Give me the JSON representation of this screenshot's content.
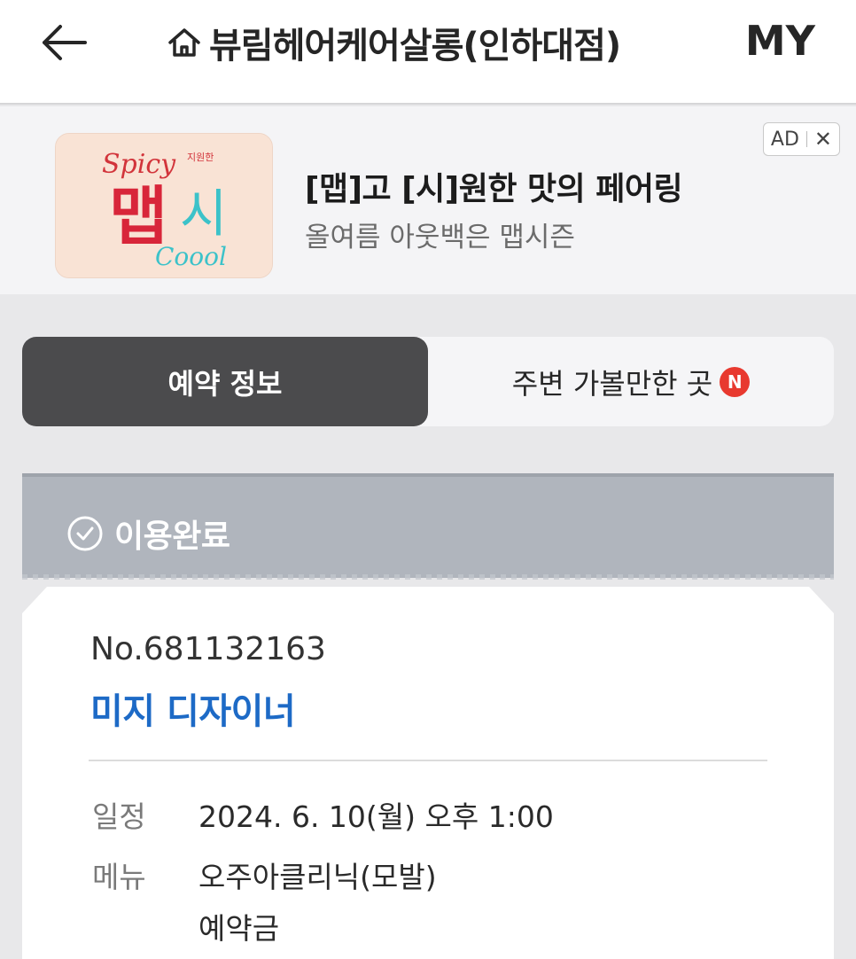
{
  "header": {
    "title": "뷰림헤어케어살롱(인하대점)",
    "my_label": "MY"
  },
  "ad": {
    "title": "[맵]고 [시]원한 맛의 페어링",
    "subtitle": "올여름 아웃백은 맵시즌",
    "badge_label": "AD",
    "close_label": "✕",
    "thumb": {
      "top_text": "Spicy",
      "main_text": "맵",
      "accent_text": "시",
      "bottom_text": "Coool",
      "small_text": "지원한"
    }
  },
  "tabs": [
    {
      "label": "예약 정보",
      "active": true
    },
    {
      "label": "주변 가볼만한 곳",
      "badge": "N",
      "active": false
    }
  ],
  "status": {
    "label": "이용완료"
  },
  "reservation": {
    "number": "No.681132163",
    "designer": "미지 디자이너",
    "rows": [
      {
        "label": "일정",
        "value": "2024. 6. 10(월) 오후 1:00"
      },
      {
        "label": "메뉴",
        "value": "오주아클리닉(모발)"
      },
      {
        "label": "",
        "value": "예약금"
      }
    ]
  },
  "colors": {
    "accent_blue": "#1d6ac6",
    "tab_active": "#4b4b4d",
    "status_bar": "#b0b5bd",
    "badge_red": "#e8392f"
  }
}
